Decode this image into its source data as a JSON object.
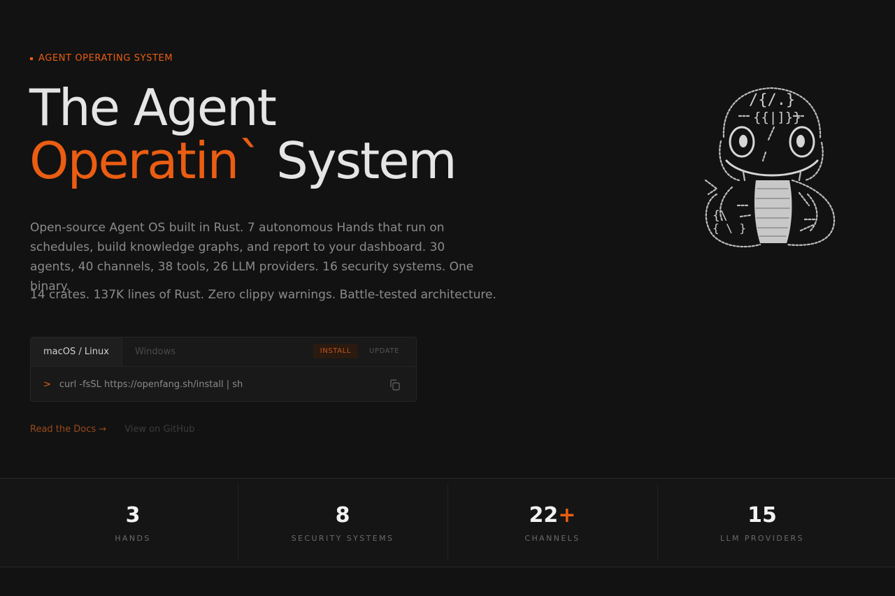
{
  "hero": {
    "eyebrow": "AGENT OPERATING SYSTEM",
    "title_line1": "The Agent",
    "title_accent": "Operatin`",
    "title_rest": " System",
    "description": "Open-source Agent OS built in Rust. 7 autonomous Hands that run on schedules, build knowledge graphs, and report to your dashboard. 30 agents, 40 channels, 38 tools, 26 LLM providers. 16 security systems. One binary.",
    "description2": "14 crates. 137K lines of Rust. Zero clippy warnings. Battle-tested architecture."
  },
  "install": {
    "tabs": [
      "macOS / Linux",
      "Windows"
    ],
    "active_tab": "macOS / Linux",
    "modes": [
      "INSTALL",
      "UPDATE"
    ],
    "active_mode": "INSTALL",
    "prompt": ">",
    "command": "curl -fsSL https://openfang.sh/install | sh"
  },
  "links": {
    "docs": "Read the Docs →",
    "github": "View on GitHub"
  },
  "stats": [
    {
      "value": "3",
      "suffix": "",
      "label": "HANDS"
    },
    {
      "value": "8",
      "suffix": "",
      "label": "SECURITY SYSTEMS"
    },
    {
      "value": "22",
      "suffix": "+",
      "label": "CHANNELS"
    },
    {
      "value": "15",
      "suffix": "",
      "label": "LLM PROVIDERS"
    }
  ],
  "colors": {
    "background": "#121212",
    "accent": "#ea5d12",
    "text": "#e5e5e5",
    "muted": "#8b8b8b"
  },
  "mascot": {
    "icon": "ascii-snake-mascot",
    "glyphs_top": "/{/.}",
    "glyphs_mid": "{{|]}}",
    "glyphs_body1": "{\\",
    "glyphs_body2": "{ \\ }"
  }
}
